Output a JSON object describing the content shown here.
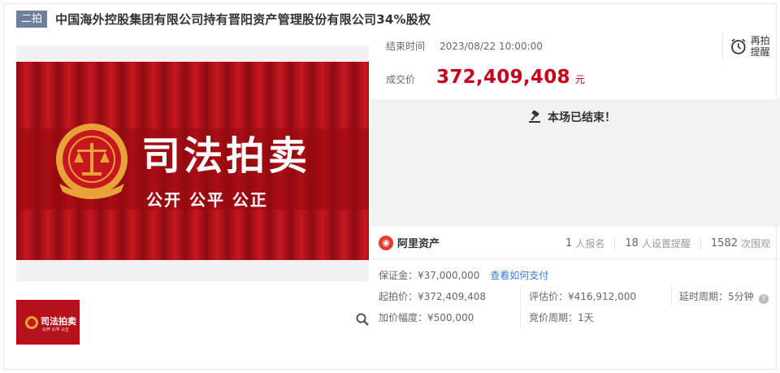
{
  "header": {
    "round_badge": "二拍",
    "title": "中国海外控股集团有限公司持有晋阳资产管理股份有限公司34%股权"
  },
  "banner": {
    "headline": "司法拍卖",
    "slogan": "公开 公平 公正",
    "thumb_headline": "司法拍卖",
    "thumb_slogan": "公开 公平 公正",
    "colors": {
      "curtain": "#b5121b",
      "gold": "#e8a23a"
    }
  },
  "auction": {
    "end_label": "结束时间",
    "end_time": "2023/08/22 10:00:00",
    "remind_label": "再拍提醒",
    "deal_label": "成交价",
    "deal_price": "372,409,408",
    "deal_unit": "元",
    "ended_text": "本场已结束！"
  },
  "platform": {
    "name": "阿里资产",
    "stats": [
      {
        "num": "1",
        "label": "人报名"
      },
      {
        "num": "18",
        "label": "人设置提醒"
      },
      {
        "num": "1582",
        "label": "次围观"
      }
    ]
  },
  "details": {
    "deposit_label": "保证金：",
    "deposit": "¥37,000,000",
    "pay_link": "查看如何支付",
    "start_price_label": "起拍价：",
    "start_price": "¥372,409,408",
    "appraisal_label": "评估价：",
    "appraisal": "¥416,912,000",
    "delay_label": "延时周期：",
    "delay": "5分钟",
    "increment_label": "加价幅度：",
    "increment": "¥500,000",
    "bid_cycle_label": "竞价周期：",
    "bid_cycle": "1天"
  },
  "colors": {
    "accent": "#c4001c",
    "link": "#3a7ad9",
    "badge": "#6d7f9c"
  }
}
